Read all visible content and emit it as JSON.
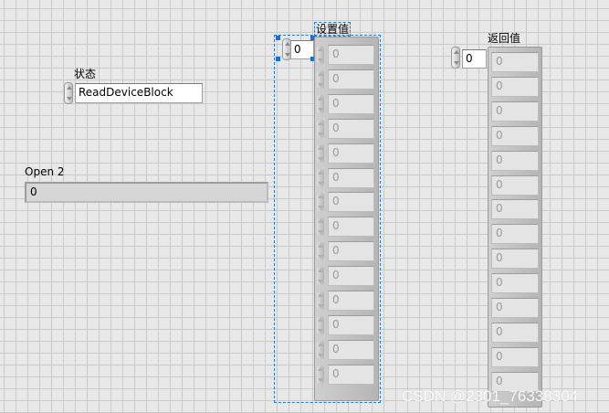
{
  "state": {
    "label": "状态",
    "value": "ReadDeviceBlock"
  },
  "open2": {
    "label": "Open 2",
    "value": "0"
  },
  "setting": {
    "label": "设置值",
    "index": "0",
    "cells": [
      "0",
      "0",
      "0",
      "0",
      "0",
      "0",
      "0",
      "0",
      "0",
      "0",
      "0",
      "0",
      "0",
      "0"
    ]
  },
  "returned": {
    "label": "返回值",
    "index": "0",
    "cells": [
      "0",
      "0",
      "0",
      "0",
      "0",
      "0",
      "0",
      "0",
      "0",
      "0",
      "0",
      "0",
      "0",
      "0"
    ]
  },
  "watermark": "CSDN @2301_76338304"
}
